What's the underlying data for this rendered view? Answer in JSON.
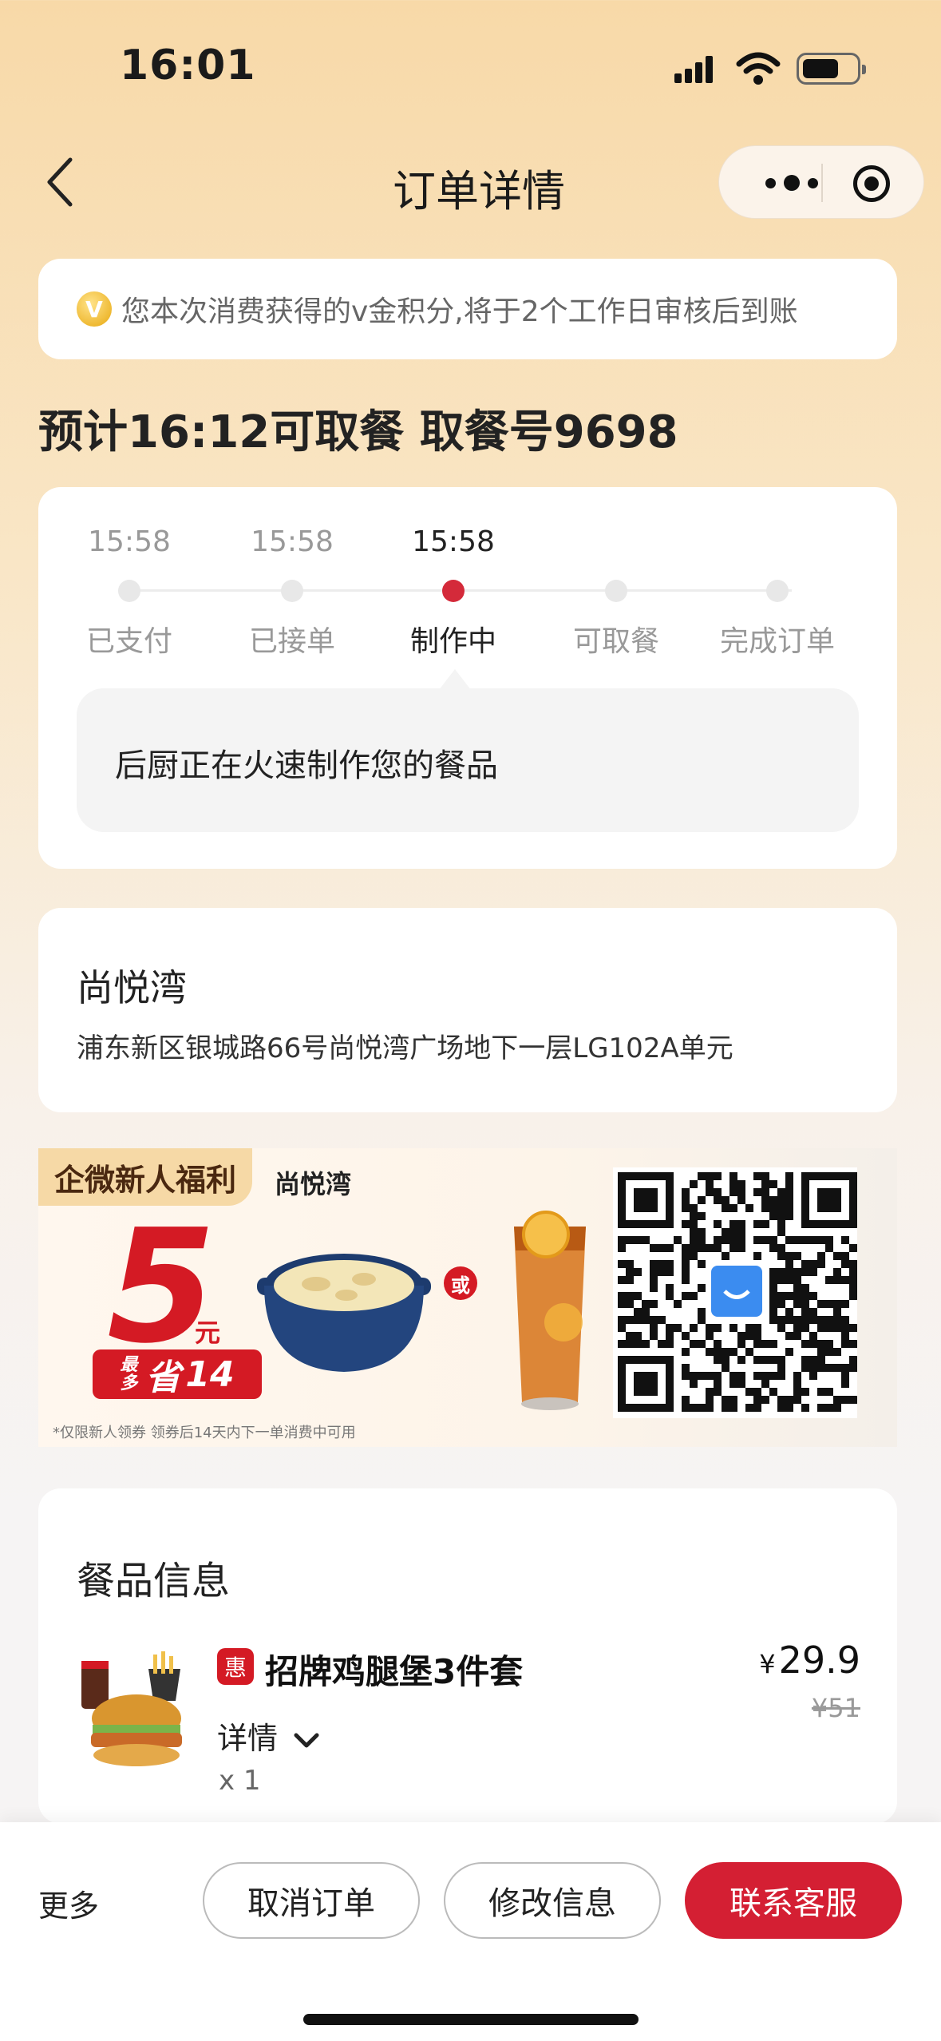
{
  "status_bar": {
    "time": "16:01"
  },
  "nav": {
    "title": "订单详情"
  },
  "notice": {
    "coin_icon_text": "V",
    "text": "您本次消费获得的v金积分,将于2个工作日审核后到账"
  },
  "headline": "预计16:12可取餐  取餐号9698",
  "progress": {
    "steps": [
      {
        "time": "15:58",
        "label": "已支付"
      },
      {
        "time": "15:58",
        "label": "已接单"
      },
      {
        "time": "15:58",
        "label": "制作中"
      },
      {
        "time": "",
        "label": "可取餐"
      },
      {
        "time": "",
        "label": "完成订单"
      }
    ],
    "active_step": 2,
    "message": "后厨正在火速制作您的餐品"
  },
  "store": {
    "name": "尚悦湾",
    "address": "浦东新区银城路66号尚悦湾广场地下一层LG102A单元"
  },
  "promo": {
    "tag": "企微新人福利",
    "store": "尚悦湾",
    "price": "5",
    "unit": "元",
    "save_prefix": "最多",
    "save_word": "省",
    "save_amount": "14",
    "or": "或",
    "note": "*仅限新人领券   领券后14天内下一单消费中可用"
  },
  "food": {
    "section_title": "餐品信息",
    "items": [
      {
        "badge": "惠",
        "name": "招牌鸡腿堡3件套",
        "currency": "¥",
        "price": "29.9",
        "original_price": "¥51",
        "detail_label": "详情",
        "quantity": "x 1"
      }
    ]
  },
  "bottom_bar": {
    "more": "更多",
    "cancel": "取消订单",
    "modify": "修改信息",
    "contact": "联系客服"
  },
  "colors": {
    "accent": "#d41f33",
    "background_top": "#f8d9a8"
  }
}
